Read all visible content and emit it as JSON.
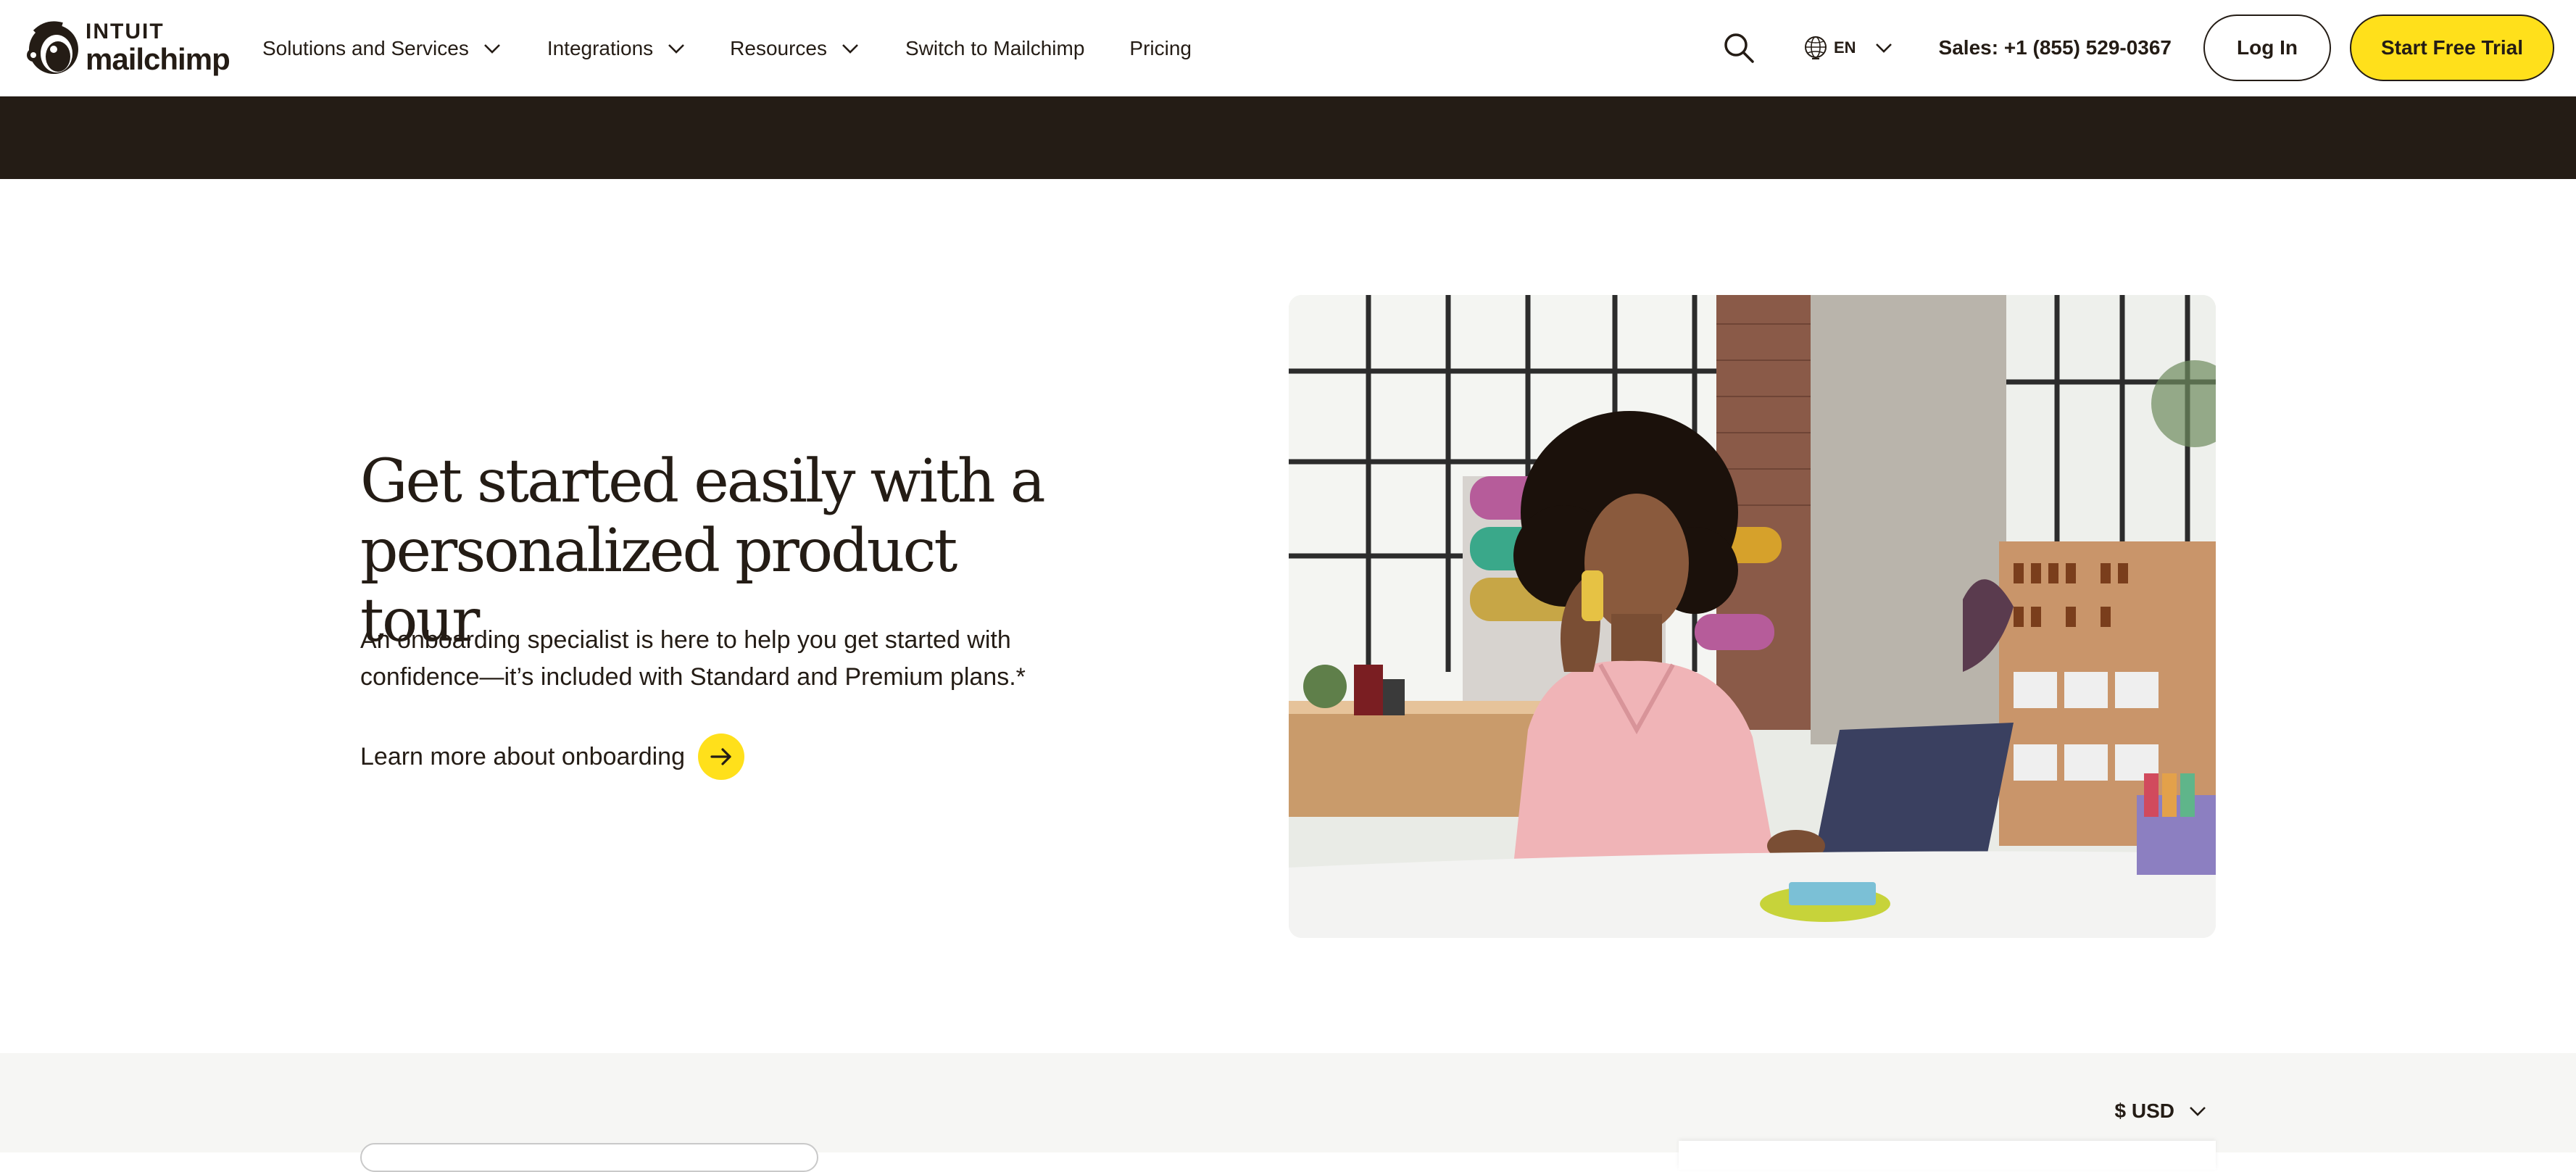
{
  "header": {
    "logo": {
      "top_text": "INTUIT",
      "bottom_text": "mailchimp"
    },
    "nav": [
      {
        "label": "Solutions and Services",
        "has_dropdown": true
      },
      {
        "label": "Integrations",
        "has_dropdown": true
      },
      {
        "label": "Resources",
        "has_dropdown": true
      },
      {
        "label": "Switch to Mailchimp",
        "has_dropdown": false
      },
      {
        "label": "Pricing",
        "has_dropdown": false
      }
    ],
    "language": "EN",
    "sales": "Sales: +1 (855) 529-0367",
    "login_label": "Log In",
    "trial_label": "Start Free Trial"
  },
  "hero": {
    "title_line1": "Get started easily with a",
    "title_line2": "personalized product tour",
    "body": "An onboarding specialist is here to help you get started with confidence—it’s included with Standard and Premium plans.*",
    "link_label": "Learn more about onboarding"
  },
  "pricing": {
    "currency": "$ USD"
  },
  "colors": {
    "brand_yellow": "#ffe01b",
    "peppercorn": "#241c15",
    "light_gray": "#f6f6f4"
  },
  "icons": [
    "mailchimp-logo",
    "chevron-down-icon",
    "search-icon",
    "globe-icon",
    "arrow-right-icon"
  ]
}
